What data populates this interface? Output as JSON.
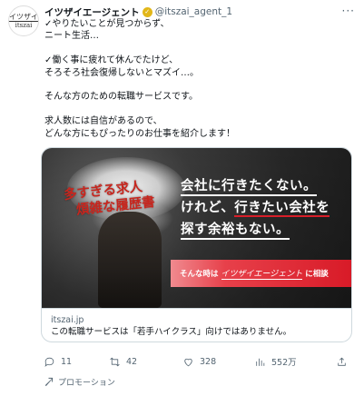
{
  "tweet": {
    "author_name": "イツザイエージェント",
    "handle": "@itszai_agent_1",
    "more_label": "···",
    "text": "✓やりたいことが見つからず、\nニート生活…\n\n✓働く事に疲れて休んでたけど、\nそろそろ社会復帰しないとマズイ…。\n\nそんな方のための転職サービスです。\n\n求人数には自信があるので、\nどんな方にもぴったりのお仕事を紹介します！"
  },
  "avatar": {
    "logo_top": "イツザイ",
    "logo_bottom": "itszai"
  },
  "card": {
    "image_red_line1": "多すぎる求人",
    "image_red_line2": "煩雑な履歴書",
    "headline_line1": "会社に行きたくない。",
    "headline_line2a": "けれど、",
    "headline_line2b": "行きたい会社を",
    "headline_line3": "探す余裕もない。",
    "ribbon_prefix": "そんな時は",
    "ribbon_brand": "イツザイエージェント",
    "ribbon_cta": "に相談",
    "domain": "itszai.jp",
    "title": "この転職サービスは「若手ハイクラス」向けではありません。"
  },
  "actions": {
    "replies": "11",
    "retweets": "42",
    "likes": "328",
    "views": "552万"
  },
  "promo_label": "プロモーション",
  "colors": {
    "accent_red": "#d81e29",
    "badge_gold": "#e2b719",
    "muted_text": "#536471"
  }
}
